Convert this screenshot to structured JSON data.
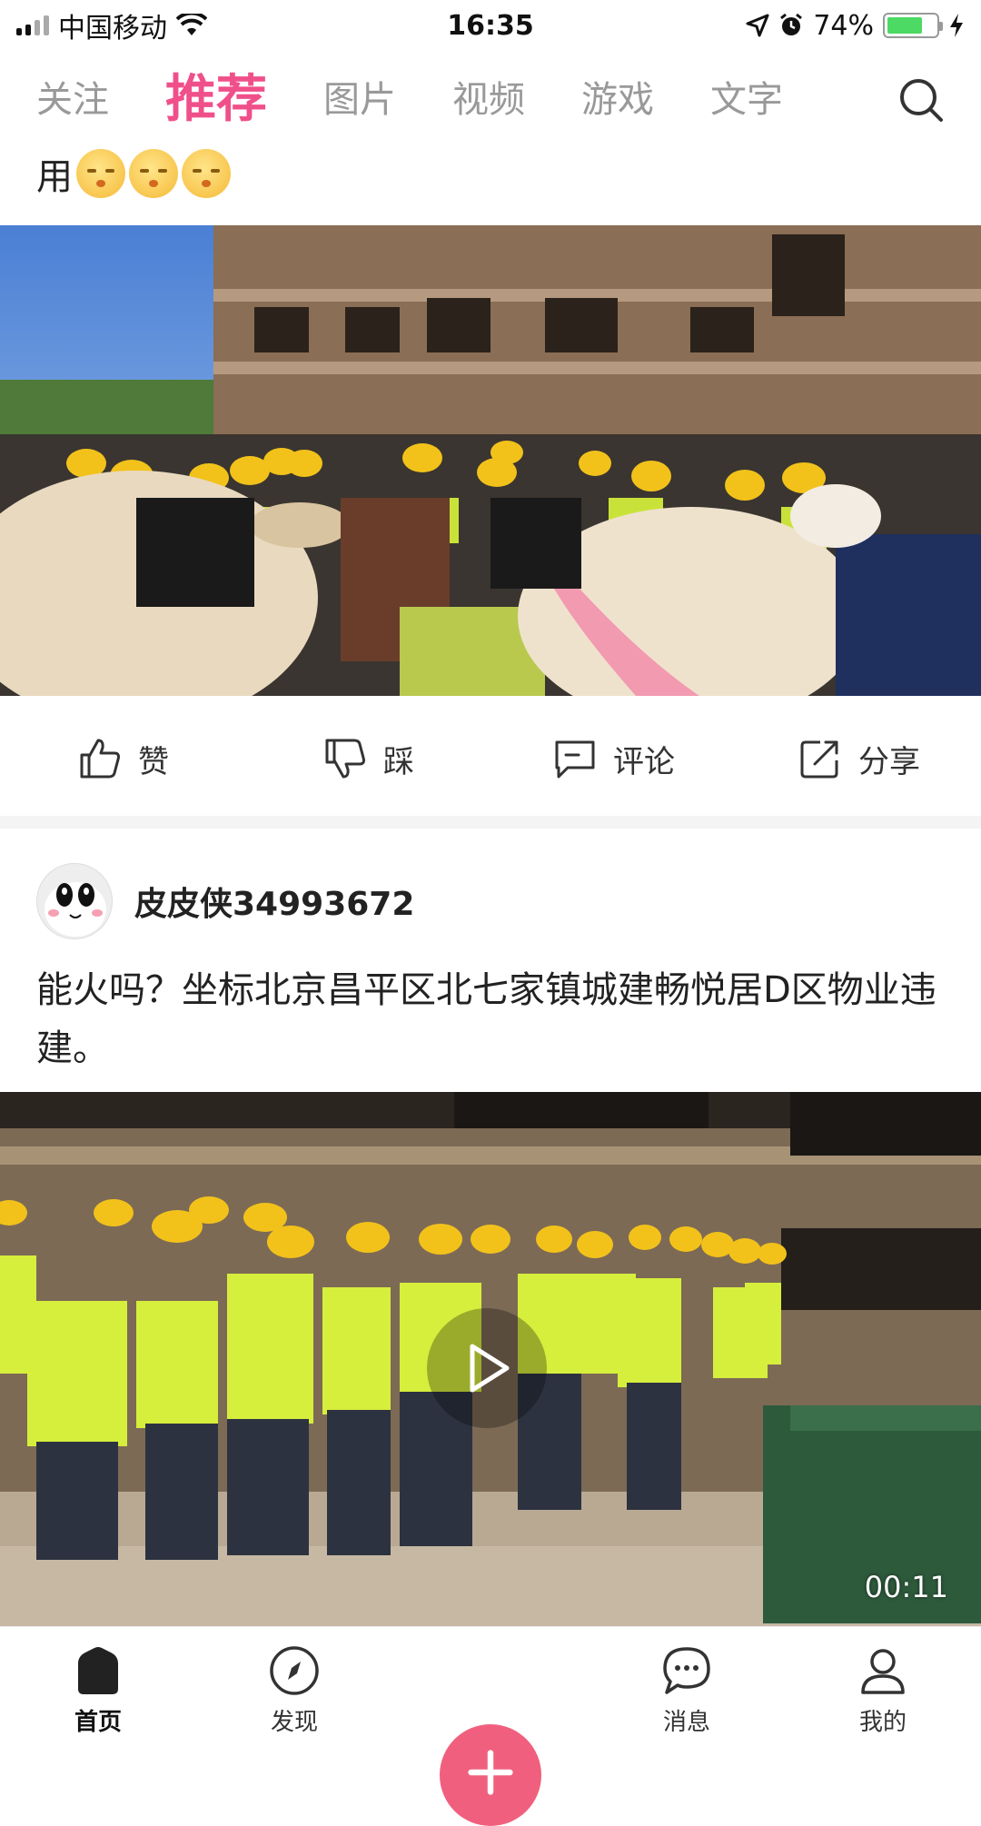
{
  "status_bar": {
    "carrier": "中国移动",
    "time": "16:35",
    "battery_percent": "74%",
    "battery_level": 0.74,
    "icons": [
      "signal-icon",
      "wifi-icon",
      "location-icon",
      "alarm-icon",
      "battery-icon",
      "charging-icon"
    ]
  },
  "tabs": [
    {
      "label": "关注",
      "active": false
    },
    {
      "label": "推荐",
      "active": true
    },
    {
      "label": "图片",
      "active": false
    },
    {
      "label": "视频",
      "active": false
    },
    {
      "label": "游戏",
      "active": false
    },
    {
      "label": "文字",
      "active": false
    }
  ],
  "post1": {
    "text_tail": "用",
    "emoji_count": 3,
    "actions": [
      {
        "label": "赞",
        "icon": "thumbs-up-icon"
      },
      {
        "label": "踩",
        "icon": "thumbs-down-icon"
      },
      {
        "label": "评论",
        "icon": "comment-icon"
      },
      {
        "label": "分享",
        "icon": "share-icon"
      }
    ]
  },
  "post2": {
    "username": "皮皮侠34993672",
    "text": "能火吗？坐标北京昌平区北七家镇城建畅悦居D区物业违建。",
    "video_duration": "00:11"
  },
  "bottom_nav": [
    {
      "label": "首页",
      "icon": "home-icon",
      "active": true
    },
    {
      "label": "发现",
      "icon": "compass-icon",
      "active": false
    },
    {
      "label": "",
      "icon": "plus-icon",
      "active": false
    },
    {
      "label": "消息",
      "icon": "message-icon",
      "active": false
    },
    {
      "label": "我的",
      "icon": "profile-icon",
      "active": false
    }
  ],
  "colors": {
    "accent": "#f0508a",
    "post_button": "#f0607e",
    "inactive_tab": "#999999"
  }
}
